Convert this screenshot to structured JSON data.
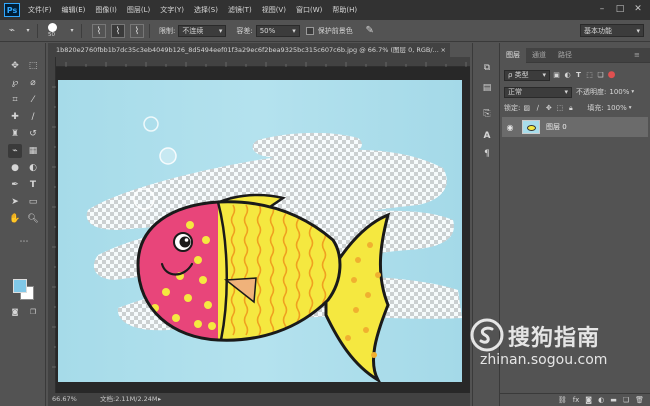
{
  "app": {
    "logo": "Ps",
    "menu": [
      "文件(F)",
      "编辑(E)",
      "图像(I)",
      "图层(L)",
      "文字(Y)",
      "选择(S)",
      "滤镜(T)",
      "视图(V)",
      "窗口(W)",
      "帮助(H)"
    ],
    "window_controls": [
      "–",
      "□",
      "✕"
    ]
  },
  "options_bar": {
    "brush_size": "50",
    "limits_label": "限制:",
    "limits_value": "不连续",
    "tolerance_label": "容差:",
    "tolerance_value": "50%",
    "protect_fg_label": "保护前景色",
    "workspace": "基本功能"
  },
  "document": {
    "tab_title": "1b820e2760fbb1b7dc35c3eb4049b126_8d5494eef01f3a29ec6f2bea9325bc315c607c6b.jpg @ 66.7% (图层 0, RGB/...",
    "close": "×"
  },
  "status": {
    "zoom": "66.67%",
    "doc_info": "文档:2.11M/2.24M"
  },
  "layers_panel": {
    "tabs": [
      "图层",
      "通道",
      "路径"
    ],
    "filter_label": "ρ 类型",
    "blend_mode": "正常",
    "opacity_label": "不透明度:",
    "opacity_value": "100%",
    "lock_label": "锁定:",
    "fill_label": "填充:",
    "fill_value": "100%",
    "layers": [
      {
        "name": "图层 0",
        "visible": true
      }
    ]
  },
  "watermark": {
    "text": "搜狗指南",
    "url": "zhinan.sogou.com"
  },
  "colors": {
    "foreground": "#80c8e8",
    "background": "#ffffff",
    "fish_pink": "#e8457a",
    "fish_yellow": "#f5e840"
  }
}
